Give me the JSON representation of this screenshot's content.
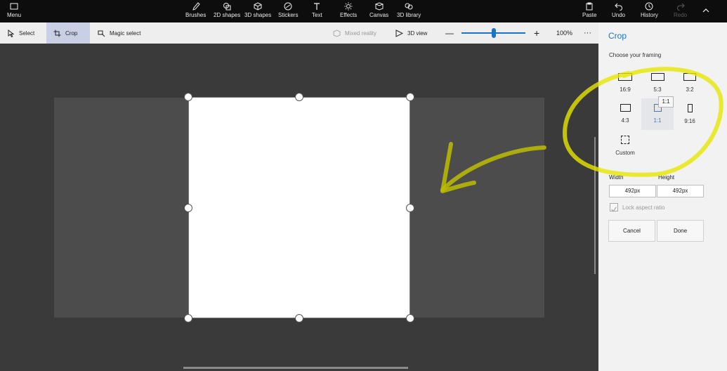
{
  "toolbar": {
    "menu": "Menu",
    "brushes": "Brushes",
    "shapes2d": "2D shapes",
    "shapes3d": "3D shapes",
    "stickers": "Stickers",
    "text": "Text",
    "effects": "Effects",
    "canvas": "Canvas",
    "library3d": "3D library",
    "paste": "Paste",
    "undo": "Undo",
    "history": "History",
    "redo": "Redo"
  },
  "subbar": {
    "select": "Select",
    "crop": "Crop",
    "magic_select": "Magic select",
    "mixed_reality": "Mixed reality",
    "view3d": "3D view",
    "zoom_minus": "—",
    "zoom_plus": "+",
    "zoom_level": "100%",
    "more": "···"
  },
  "panel": {
    "title": "Crop",
    "subtitle": "Choose your framing",
    "framings": [
      {
        "label": "16:9"
      },
      {
        "label": "5:3"
      },
      {
        "label": "3:2"
      },
      {
        "label": "4:3"
      },
      {
        "label": "1:1"
      },
      {
        "label": "9:16"
      },
      {
        "label": "Custom"
      }
    ],
    "tooltip": "1:1",
    "width_label": "Width",
    "height_label": "Height",
    "width_value": "492px",
    "height_value": "492px",
    "lock_label": "Lock aspect ratio",
    "cancel": "Cancel",
    "done": "Done"
  },
  "colors": {
    "accent": "#1a73c8",
    "annotation": "#e6e600"
  }
}
